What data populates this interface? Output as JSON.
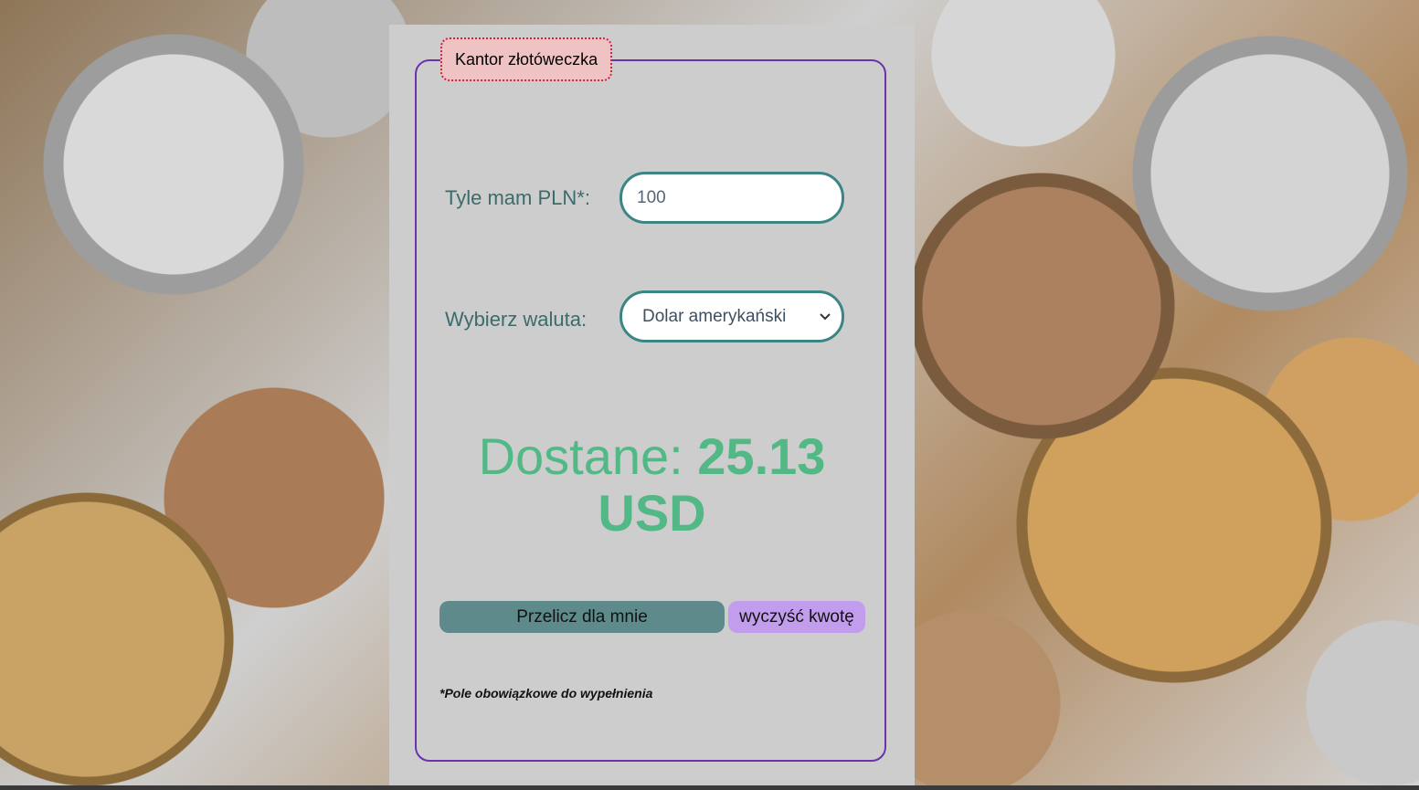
{
  "form": {
    "title": "Kantor złotóweczka",
    "amount_label": "Tyle mam PLN*:",
    "amount_value": "100",
    "currency_label": "Wybierz waluta:",
    "currency_selected": "Dolar amerykański",
    "result_prefix": "Dostane:",
    "result_amount": "25.13",
    "result_currency": "USD",
    "calculate_button": "Przelicz dla mnie",
    "clear_button": "wyczyść kwotę",
    "required_note": "*Pole obowiązkowe do wypełnienia"
  },
  "icons": {
    "select_arrow": "chevron-down-icon"
  },
  "colors": {
    "panel": "#cdcdcd",
    "fieldset_border": "#6b32b0",
    "legend_background": "#efc3c3",
    "legend_border": "#c8283f",
    "label_text": "#3d6b6b",
    "input_border": "#3b8585",
    "result_text": "#52b885",
    "calculate_button": "#5e8a8b",
    "clear_button": "#c39ded"
  }
}
